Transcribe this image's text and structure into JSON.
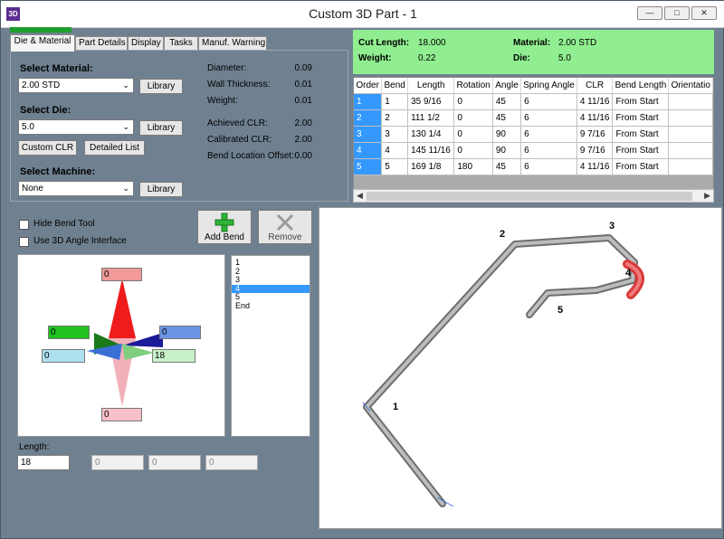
{
  "window": {
    "icon": "3D",
    "title": "Custom 3D Part - 1"
  },
  "tabs": [
    "Die & Material",
    "Part Details",
    "Display",
    "Tasks",
    "Manuf. Warning"
  ],
  "die_material": {
    "select_material_label": "Select Material:",
    "material_value": "2.00 STD",
    "select_die_label": "Select Die:",
    "die_value": "5.0",
    "select_machine_label": "Select Machine:",
    "machine_value": "None",
    "library_label": "Library",
    "custom_clr_label": "Custom CLR",
    "detailed_list_label": "Detailed List",
    "props": [
      {
        "label": "Diameter:",
        "value": "0.09"
      },
      {
        "label": "Wall Thickness:",
        "value": "0.01"
      },
      {
        "label": "Weight:",
        "value": "0.01"
      },
      {
        "label": "Achieved CLR:",
        "value": "2.00"
      },
      {
        "label": "Calibrated CLR:",
        "value": "2.00"
      },
      {
        "label": "Bend Location Offset:",
        "value": "0.00"
      }
    ]
  },
  "summary": {
    "cut_length_label": "Cut Length:",
    "cut_length": "18.000",
    "weight_label": "Weight:",
    "weight": "0.22",
    "material_label": "Material:",
    "material": "2.00 STD",
    "die_label": "Die:",
    "die": "5.0"
  },
  "grid": {
    "columns": [
      "Order",
      "Bend",
      "Length",
      "Rotation",
      "Angle",
      "Spring Angle",
      "CLR",
      "Bend Length",
      "Orientatio"
    ],
    "rows": [
      [
        "1",
        "1",
        "35 9/16",
        "0",
        "45",
        "6",
        "4 11/16",
        "From Start"
      ],
      [
        "2",
        "2",
        "111 1/2",
        "0",
        "45",
        "6",
        "4 11/16",
        "From Start"
      ],
      [
        "3",
        "3",
        "130 1/4",
        "0",
        "90",
        "6",
        "9 7/16",
        "From Start"
      ],
      [
        "4",
        "4",
        "145 11/16",
        "0",
        "90",
        "6",
        "9 7/16",
        "From Start"
      ],
      [
        "5",
        "5",
        "169 1/8",
        "180",
        "45",
        "6",
        "4 11/16",
        "From Start"
      ]
    ]
  },
  "tools": {
    "hide_bend_tool_label": "Hide Bend Tool",
    "use_3d_angle_label": "Use 3D Angle Interface",
    "add_bend_label": "Add Bend",
    "remove_label": "Remove"
  },
  "gizmo": {
    "top": "0",
    "left_green": "0",
    "right_blue": "0",
    "left_light": "0",
    "right_green": "18",
    "bottom": "0"
  },
  "bend_list": [
    "1",
    "2",
    "3",
    "4",
    "5",
    "End"
  ],
  "length": {
    "label": "Length:",
    "value": "18",
    "f1": "0",
    "f2": "0",
    "f3": "0"
  },
  "viewport_labels": [
    "1",
    "2",
    "3",
    "4",
    "5"
  ]
}
